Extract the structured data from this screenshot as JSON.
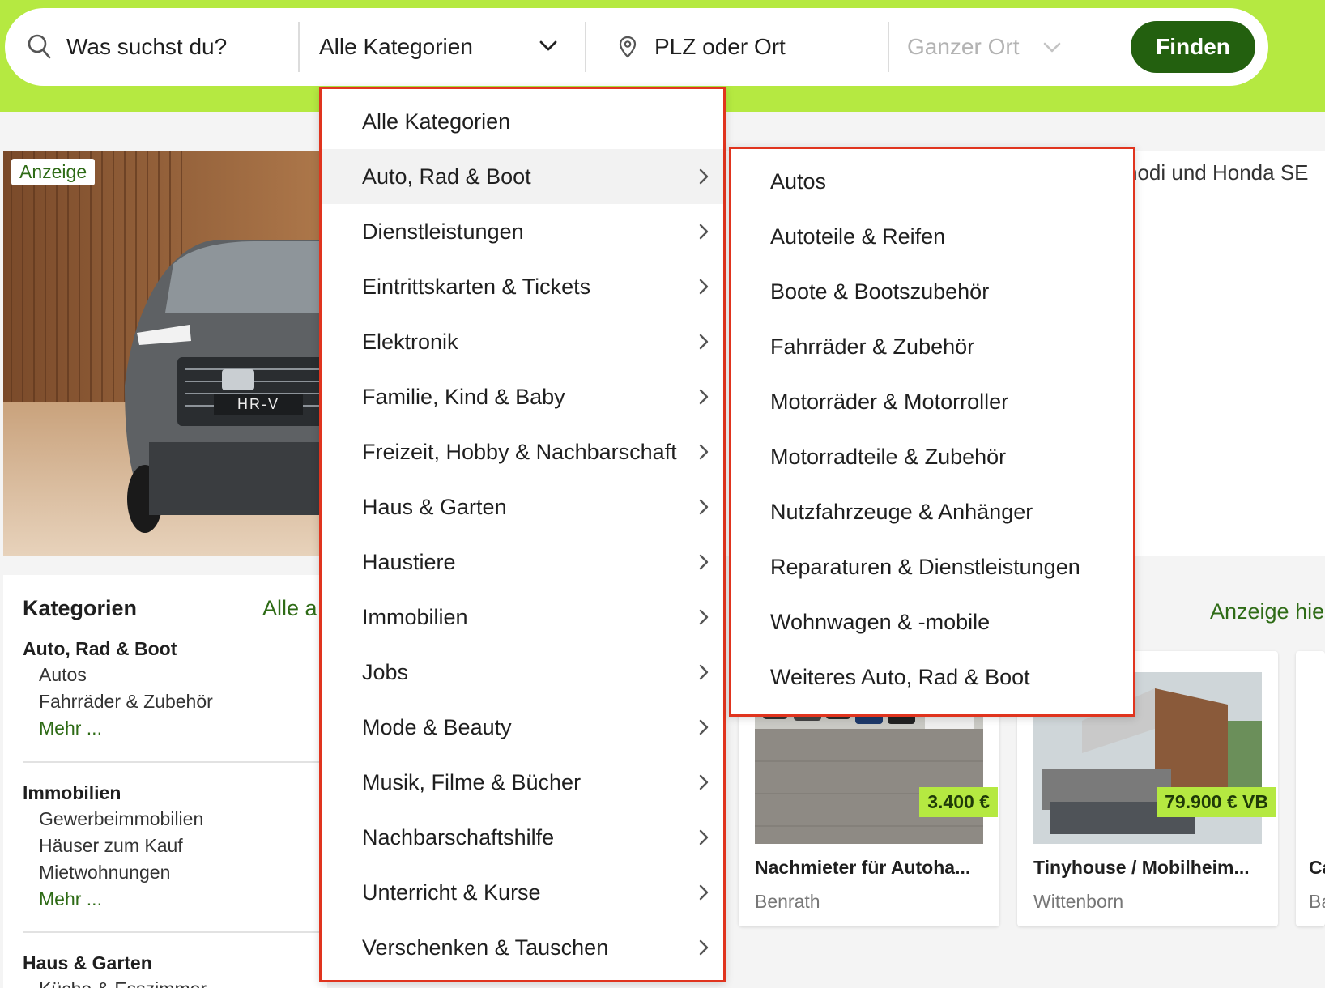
{
  "header": {
    "search_placeholder": "Was suchst du?",
    "category_select": "Alle Kategorien",
    "location_placeholder": "PLZ oder Ort",
    "radius_select": "Ganzer Ort",
    "find_button": "Finden",
    "accent_color": "#b5e941",
    "button_color": "#23600f"
  },
  "hero": {
    "ad_tag": "Anzeige",
    "copy_fragment": "nodi und Honda SE",
    "car_badge": "HR-V"
  },
  "categories_card": {
    "title": "Kategorien",
    "all_link": "Alle a",
    "groups": [
      {
        "title": "Auto, Rad & Boot",
        "items": [
          "Autos",
          "Fahrräder & Zubehör"
        ],
        "more": "Mehr ..."
      },
      {
        "title": "Immobilien",
        "items": [
          "Gewerbeimmobilien",
          "Häuser zum Kauf",
          "Mietwohnungen"
        ],
        "more": "Mehr ..."
      },
      {
        "title": "Haus & Garten",
        "items": [
          "Küche & Esszimmer"
        ]
      }
    ]
  },
  "ads_link": "Anzeige hie",
  "listings": [
    {
      "price": "3.400 €",
      "title": "Nachmieter für Autoha...",
      "location": "Benrath"
    },
    {
      "price": "79.900 € VB",
      "title": "Tinyhouse / Mobilheim...",
      "location": "Wittenborn"
    },
    {
      "title": "Ca",
      "location": "Ba"
    }
  ],
  "category_menu": {
    "items": [
      {
        "label": "Alle Kategorien",
        "has_sub": false
      },
      {
        "label": "Auto, Rad & Boot",
        "has_sub": true,
        "active": true
      },
      {
        "label": "Dienstleistungen",
        "has_sub": true
      },
      {
        "label": "Eintrittskarten & Tickets",
        "has_sub": true
      },
      {
        "label": "Elektronik",
        "has_sub": true
      },
      {
        "label": "Familie, Kind & Baby",
        "has_sub": true
      },
      {
        "label": "Freizeit, Hobby & Nachbarschaft",
        "has_sub": true
      },
      {
        "label": "Haus & Garten",
        "has_sub": true
      },
      {
        "label": "Haustiere",
        "has_sub": true
      },
      {
        "label": "Immobilien",
        "has_sub": true
      },
      {
        "label": "Jobs",
        "has_sub": true
      },
      {
        "label": "Mode & Beauty",
        "has_sub": true
      },
      {
        "label": "Musik, Filme & Bücher",
        "has_sub": true
      },
      {
        "label": "Nachbarschaftshilfe",
        "has_sub": true
      },
      {
        "label": "Unterricht & Kurse",
        "has_sub": true
      },
      {
        "label": "Verschenken & Tauschen",
        "has_sub": true
      }
    ]
  },
  "subcategory_menu": {
    "items": [
      "Autos",
      "Autoteile & Reifen",
      "Boote & Bootszubehör",
      "Fahrräder & Zubehör",
      "Motorräder & Motorroller",
      "Motorradteile & Zubehör",
      "Nutzfahrzeuge & Anhänger",
      "Reparaturen & Dienstleistungen",
      "Wohnwagen & -mobile",
      "Weiteres Auto, Rad & Boot"
    ]
  },
  "highlight_border_color": "#e0341e"
}
